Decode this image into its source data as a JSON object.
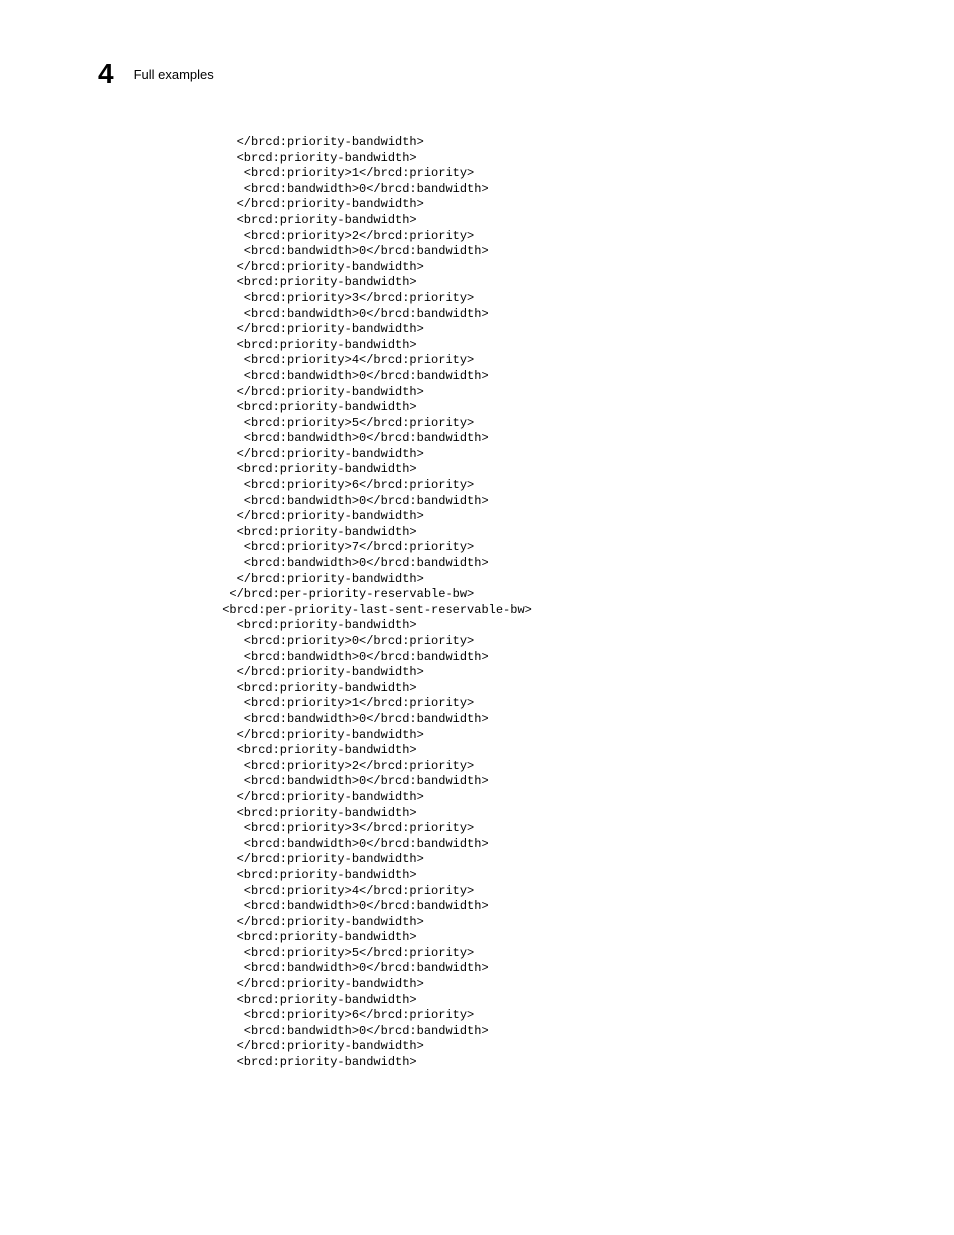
{
  "header": {
    "chapter_number": "4",
    "section_title": "Full examples"
  },
  "code": {
    "lines": [
      "   </brcd:priority-bandwidth>",
      "   <brcd:priority-bandwidth>",
      "    <brcd:priority>1</brcd:priority>",
      "    <brcd:bandwidth>0</brcd:bandwidth>",
      "   </brcd:priority-bandwidth>",
      "   <brcd:priority-bandwidth>",
      "    <brcd:priority>2</brcd:priority>",
      "    <brcd:bandwidth>0</brcd:bandwidth>",
      "   </brcd:priority-bandwidth>",
      "   <brcd:priority-bandwidth>",
      "    <brcd:priority>3</brcd:priority>",
      "    <brcd:bandwidth>0</brcd:bandwidth>",
      "   </brcd:priority-bandwidth>",
      "   <brcd:priority-bandwidth>",
      "    <brcd:priority>4</brcd:priority>",
      "    <brcd:bandwidth>0</brcd:bandwidth>",
      "   </brcd:priority-bandwidth>",
      "   <brcd:priority-bandwidth>",
      "    <brcd:priority>5</brcd:priority>",
      "    <brcd:bandwidth>0</brcd:bandwidth>",
      "   </brcd:priority-bandwidth>",
      "   <brcd:priority-bandwidth>",
      "    <brcd:priority>6</brcd:priority>",
      "    <brcd:bandwidth>0</brcd:bandwidth>",
      "   </brcd:priority-bandwidth>",
      "   <brcd:priority-bandwidth>",
      "    <brcd:priority>7</brcd:priority>",
      "    <brcd:bandwidth>0</brcd:bandwidth>",
      "   </brcd:priority-bandwidth>",
      "  </brcd:per-priority-reservable-bw>",
      " <brcd:per-priority-last-sent-reservable-bw>",
      "   <brcd:priority-bandwidth>",
      "    <brcd:priority>0</brcd:priority>",
      "    <brcd:bandwidth>0</brcd:bandwidth>",
      "   </brcd:priority-bandwidth>",
      "   <brcd:priority-bandwidth>",
      "    <brcd:priority>1</brcd:priority>",
      "    <brcd:bandwidth>0</brcd:bandwidth>",
      "   </brcd:priority-bandwidth>",
      "   <brcd:priority-bandwidth>",
      "    <brcd:priority>2</brcd:priority>",
      "    <brcd:bandwidth>0</brcd:bandwidth>",
      "   </brcd:priority-bandwidth>",
      "   <brcd:priority-bandwidth>",
      "    <brcd:priority>3</brcd:priority>",
      "    <brcd:bandwidth>0</brcd:bandwidth>",
      "   </brcd:priority-bandwidth>",
      "   <brcd:priority-bandwidth>",
      "    <brcd:priority>4</brcd:priority>",
      "    <brcd:bandwidth>0</brcd:bandwidth>",
      "   </brcd:priority-bandwidth>",
      "   <brcd:priority-bandwidth>",
      "    <brcd:priority>5</brcd:priority>",
      "    <brcd:bandwidth>0</brcd:bandwidth>",
      "   </brcd:priority-bandwidth>",
      "   <brcd:priority-bandwidth>",
      "    <brcd:priority>6</brcd:priority>",
      "    <brcd:bandwidth>0</brcd:bandwidth>",
      "   </brcd:priority-bandwidth>",
      "   <brcd:priority-bandwidth>"
    ]
  }
}
